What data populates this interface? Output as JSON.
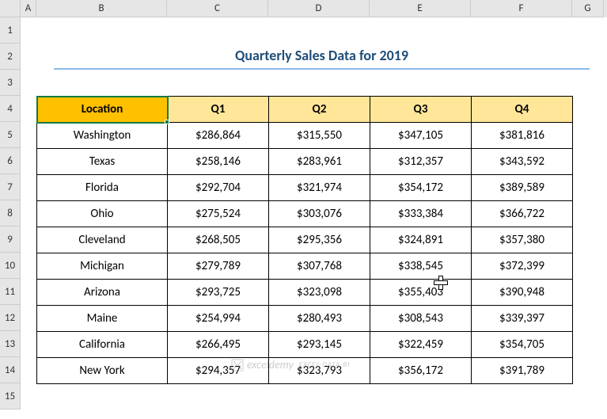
{
  "columns": [
    "A",
    "B",
    "C",
    "D",
    "E",
    "F",
    "G"
  ],
  "rows": [
    "1",
    "2",
    "3",
    "4",
    "5",
    "6",
    "7",
    "8",
    "9",
    "10",
    "11",
    "12",
    "13",
    "14",
    "15"
  ],
  "title": "Quarterly Sales Data for 2019",
  "headers": {
    "location": "Location",
    "q1": "Q1",
    "q2": "Q2",
    "q3": "Q3",
    "q4": "Q4"
  },
  "data": [
    {
      "loc": "Washington",
      "q1": "$286,864",
      "q2": "$315,550",
      "q3": "$347,105",
      "q4": "$381,816"
    },
    {
      "loc": "Texas",
      "q1": "$258,146",
      "q2": "$283,961",
      "q3": "$312,357",
      "q4": "$343,592"
    },
    {
      "loc": "Florida",
      "q1": "$292,704",
      "q2": "$321,974",
      "q3": "$354,172",
      "q4": "$389,589"
    },
    {
      "loc": "Ohio",
      "q1": "$275,524",
      "q2": "$303,076",
      "q3": "$333,384",
      "q4": "$366,722"
    },
    {
      "loc": "Cleveland",
      "q1": "$268,505",
      "q2": "$295,356",
      "q3": "$324,891",
      "q4": "$357,380"
    },
    {
      "loc": "Michigan",
      "q1": "$279,789",
      "q2": "$307,768",
      "q3": "$338,545",
      "q4": "$372,399"
    },
    {
      "loc": "Arizona",
      "q1": "$293,725",
      "q2": "$323,098",
      "q3": "$355,403",
      "q4": "$390,948"
    },
    {
      "loc": "Maine",
      "q1": "$254,994",
      "q2": "$280,493",
      "q3": "$308,543",
      "q4": "$339,397"
    },
    {
      "loc": "California",
      "q1": "$266,495",
      "q2": "$293,145",
      "q3": "$322,459",
      "q4": "$354,705"
    },
    {
      "loc": "New York",
      "q1": "$294,357",
      "q2": "$323,793",
      "q3": "$356,172",
      "q4": "$391,789"
    }
  ],
  "watermark": "exceldemy",
  "chart_data": {
    "type": "table",
    "title": "Quarterly Sales Data for 2019",
    "categories": [
      "Q1",
      "Q2",
      "Q3",
      "Q4"
    ],
    "series": [
      {
        "name": "Washington",
        "values": [
          286864,
          315550,
          347105,
          381816
        ]
      },
      {
        "name": "Texas",
        "values": [
          258146,
          283961,
          312357,
          343592
        ]
      },
      {
        "name": "Florida",
        "values": [
          292704,
          321974,
          354172,
          389589
        ]
      },
      {
        "name": "Ohio",
        "values": [
          275524,
          303076,
          333384,
          366722
        ]
      },
      {
        "name": "Cleveland",
        "values": [
          268505,
          295356,
          324891,
          357380
        ]
      },
      {
        "name": "Michigan",
        "values": [
          279789,
          307768,
          338545,
          372399
        ]
      },
      {
        "name": "Arizona",
        "values": [
          293725,
          323098,
          355403,
          390948
        ]
      },
      {
        "name": "Maine",
        "values": [
          254994,
          280493,
          308543,
          339397
        ]
      },
      {
        "name": "California",
        "values": [
          266495,
          293145,
          322459,
          354705
        ]
      },
      {
        "name": "New York",
        "values": [
          294357,
          323793,
          356172,
          391789
        ]
      }
    ]
  }
}
